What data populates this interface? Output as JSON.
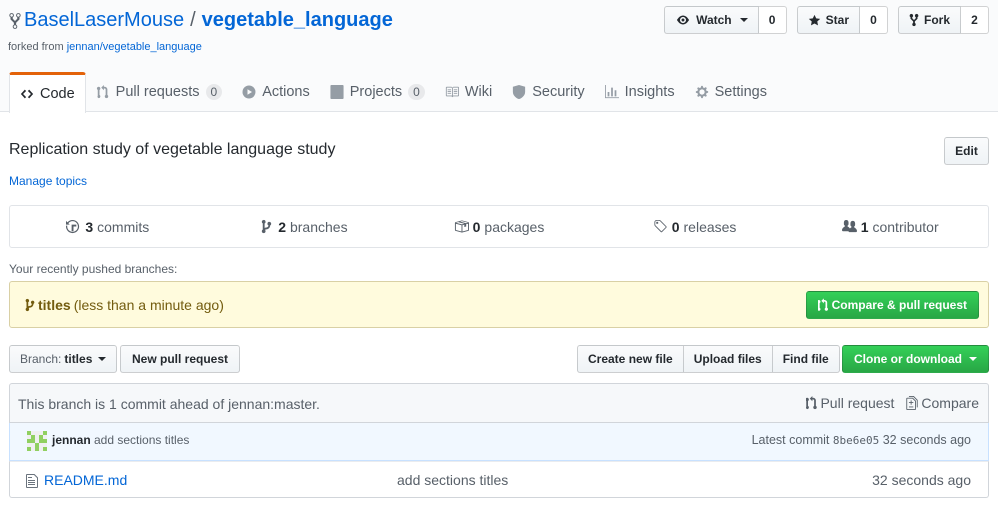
{
  "repo": {
    "owner": "BaselLaserMouse",
    "separator": "/",
    "name": "vegetable_language",
    "forked_prefix": "forked from",
    "forked_source": "jennan/vegetable_language"
  },
  "actions": {
    "watch_label": "Watch",
    "watch_count": "0",
    "star_label": "Star",
    "star_count": "0",
    "fork_label": "Fork",
    "fork_count": "2"
  },
  "nav": {
    "code": "Code",
    "pull_requests": "Pull requests",
    "pull_requests_count": "0",
    "actions": "Actions",
    "projects": "Projects",
    "projects_count": "0",
    "wiki": "Wiki",
    "security": "Security",
    "insights": "Insights",
    "settings": "Settings"
  },
  "about": {
    "description": "Replication study of vegetable language study",
    "edit_label": "Edit",
    "manage_topics": "Manage topics"
  },
  "summary": {
    "commits_num": "3",
    "commits_label": "commits",
    "branches_num": "2",
    "branches_label": "branches",
    "packages_num": "0",
    "packages_label": "packages",
    "releases_num": "0",
    "releases_label": "releases",
    "contributors_num": "1",
    "contributors_label": "contributor"
  },
  "recent": {
    "label": "Your recently pushed branches:",
    "branch": "titles",
    "when": "(less than a minute ago)",
    "compare_label": "Compare & pull request"
  },
  "file_nav": {
    "branch_prefix": "Branch:",
    "branch_name": "titles",
    "new_pr": "New pull request",
    "create_file": "Create new file",
    "upload_files": "Upload files",
    "find_file": "Find file",
    "clone": "Clone or download"
  },
  "branch_info": {
    "message": "This branch is 1 commit ahead of jennan:master.",
    "pull_request": "Pull request",
    "compare": "Compare"
  },
  "latest_commit": {
    "author": "jennan",
    "message": "add sections titles",
    "prefix": "Latest commit",
    "sha": "8be6e05",
    "age": "32 seconds ago"
  },
  "files": [
    {
      "name": "README.md",
      "message": "add sections titles",
      "age": "32 seconds ago"
    }
  ],
  "colors": {
    "link": "#0366d6",
    "green": "#28a745",
    "tab_accent": "#e36209",
    "flash_bg": "#fffbdd"
  }
}
